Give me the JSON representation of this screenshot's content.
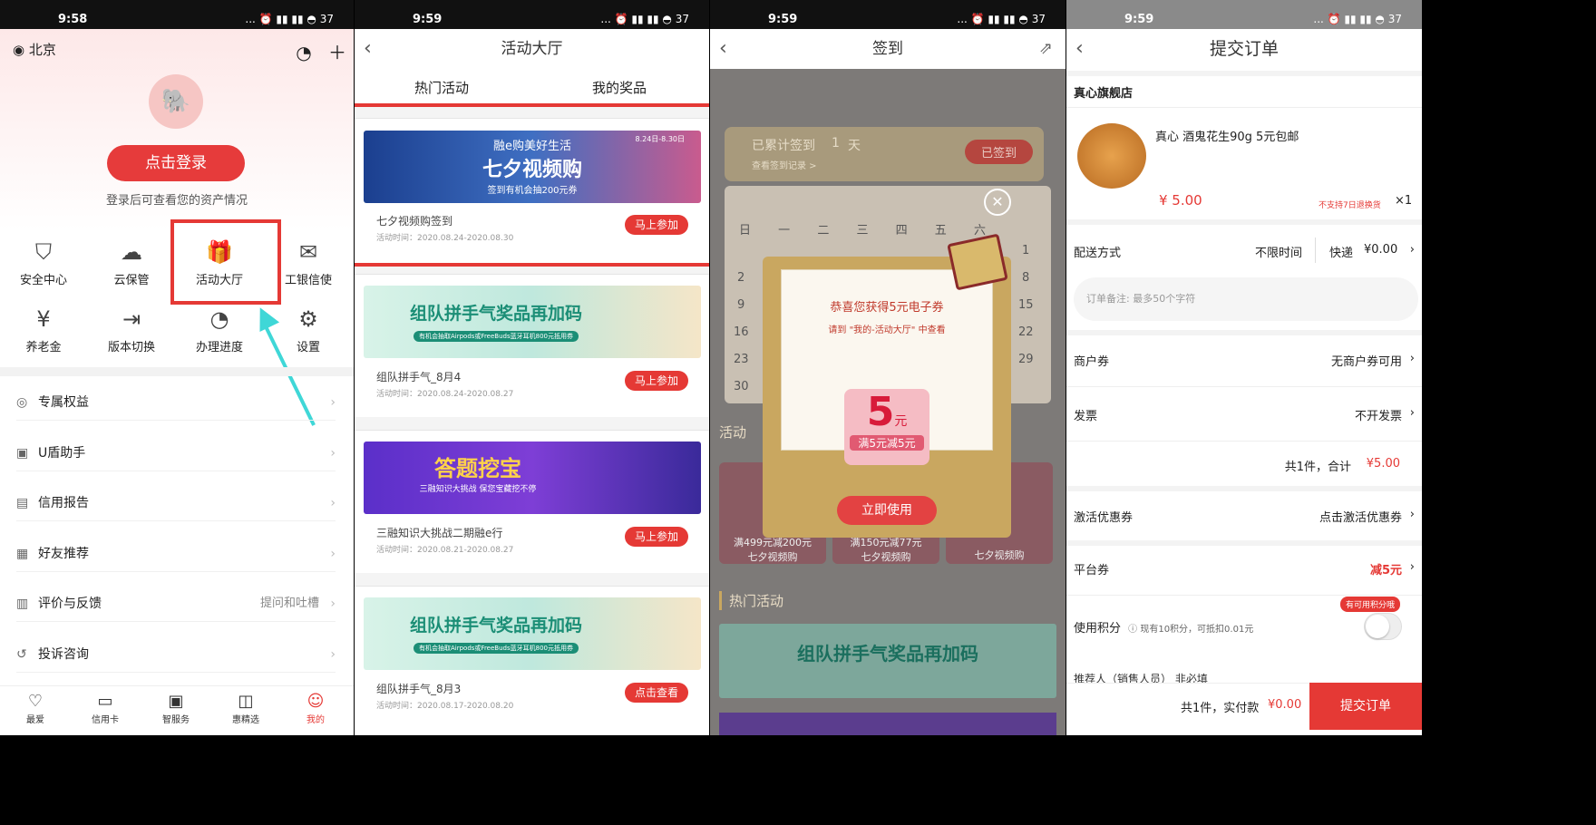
{
  "status": {
    "time1": "9:58",
    "time2": "9:59",
    "time3": "9:59",
    "time4": "9:59",
    "icons": "... ⏰ ▮▮ ▮▮ ◓ 37"
  },
  "p1": {
    "location": "北京",
    "login_label": "点击登录",
    "login_sub": "登录后可查看您的资产情况",
    "grid": [
      {
        "label": "安全中心",
        "icon": "shield-icon"
      },
      {
        "label": "云保管",
        "icon": "cloud-icon"
      },
      {
        "label": "活动大厅",
        "icon": "gift-icon"
      },
      {
        "label": "工银信使",
        "icon": "mail-icon"
      },
      {
        "label": "养老金",
        "icon": "pension-icon"
      },
      {
        "label": "版本切换",
        "icon": "switch-icon"
      },
      {
        "label": "办理进度",
        "icon": "progress-icon"
      },
      {
        "label": "设置",
        "icon": "gear-icon"
      }
    ],
    "list": [
      {
        "label": "专属权益",
        "extra": ""
      },
      {
        "label": "U盾助手",
        "extra": ""
      },
      {
        "label": "信用报告",
        "extra": ""
      },
      {
        "label": "好友推荐",
        "extra": ""
      },
      {
        "label": "评价与反馈",
        "extra": "提问和吐槽"
      },
      {
        "label": "投诉咨询",
        "extra": ""
      }
    ],
    "tabs": [
      "最爱",
      "信用卡",
      "智服务",
      "惠精选",
      "我的"
    ]
  },
  "p2": {
    "title": "活动大厅",
    "tab_hot": "热门活动",
    "tab_prize": "我的奖品",
    "cards": [
      {
        "banner_top": "融e购美好生活",
        "banner_main": "七夕视频购",
        "banner_sub": "签到有机会抽200元券",
        "date_tag": "8.24日-8.30日",
        "title": "七夕视频购签到",
        "time": "活动时间：2020.08.24-2020.08.30",
        "button": "马上参加"
      },
      {
        "banner_main": "组队拼手气奖品再加码",
        "banner_sub": "有机会抽取Airpods或FreeBuds蓝牙耳机800元抵用券",
        "title": "组队拼手气_8月4",
        "time": "活动时间：2020.08.24-2020.08.27",
        "button": "马上参加"
      },
      {
        "banner_main": "答题挖宝",
        "banner_sub": "三融知识大挑战 保您宝藏挖不停",
        "title": "三融知识大挑战二期融e行",
        "time": "活动时间：2020.08.21-2020.08.27",
        "button": "马上参加"
      },
      {
        "banner_main": "组队拼手气奖品再加码",
        "banner_sub": "有机会抽取Airpods或FreeBuds蓝牙耳机800元抵用券",
        "title": "组队拼手气_8月3",
        "time": "活动时间：2020.08.17-2020.08.20",
        "button": "点击查看"
      }
    ]
  },
  "p3": {
    "title": "签到",
    "signed_text": "已累计签到",
    "signed_days": "1",
    "signed_unit": "天",
    "record_link": "查看签到记录 >",
    "signed_button": "已签到",
    "weekdays": [
      "日",
      "一",
      "二",
      "三",
      "四",
      "五",
      "六"
    ],
    "cal_nums": [
      "1",
      "8",
      "15",
      "22",
      "29",
      "2",
      "9",
      "16",
      "23",
      "30"
    ],
    "popup_title": "恭喜您获得5元电子券",
    "popup_sub": "请到 \"我的-活动大厅\" 中查看",
    "coupon_value": "5",
    "coupon_unit": "元",
    "coupon_desc": "满5元减5元",
    "use_button": "立即使用",
    "section_activity": "活动",
    "section_hot": "热门活动",
    "bottom_cards": [
      "七夕视频购",
      "七夕视频购",
      "七夕视频购"
    ],
    "bottom_values": [
      "满499元减200元",
      "满150元减77元"
    ],
    "hot_banner": "组队拼手气奖品再加码"
  },
  "p4": {
    "title": "提交订单",
    "store": "真心旗舰店",
    "product": "真心 酒鬼花生90g 5元包邮",
    "price": "¥ 5.00",
    "no_return": "不支持7日退换货",
    "qty": "×1",
    "delivery_label": "配送方式",
    "delivery_time": "不限时间",
    "delivery_method": "快递",
    "delivery_fee": "¥0.00",
    "remark_placeholder": "订单备注: 最多50个字符",
    "merchant_coupon_label": "商户券",
    "merchant_coupon_value": "无商户券可用",
    "invoice_label": "发票",
    "invoice_value": "不开发票",
    "summary": "共1件，合计",
    "summary_amount": "¥5.00",
    "activate_label": "激活优惠券",
    "activate_value": "点击激活优惠券",
    "platform_label": "平台券",
    "platform_value": "减5元",
    "points_label": "使用积分",
    "points_info": "ⓘ 现有10积分，可抵扣0.01元",
    "points_badge": "有可用积分哦",
    "referrer": "推荐人（销售人员）  非必填",
    "pay_text": "共1件，实付款",
    "pay_amount": "¥0.00",
    "submit": "提交订单"
  }
}
